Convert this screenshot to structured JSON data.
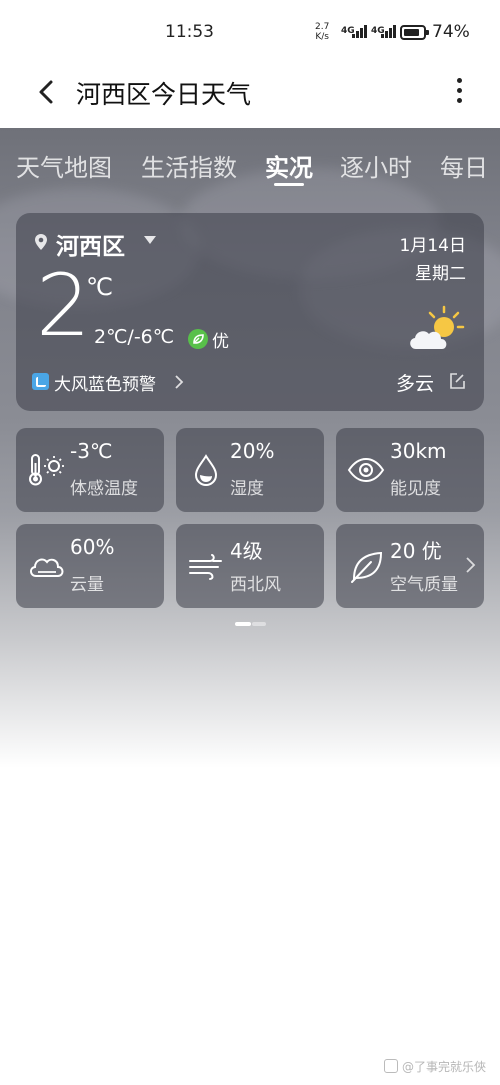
{
  "status_bar": {
    "time": "11:53",
    "net_speed_value": "2.7",
    "net_speed_unit": "K/s",
    "signal_1": "4G",
    "signal_2": "4G",
    "battery": "74%"
  },
  "header": {
    "title": "河西区今日天气",
    "back_icon": "chevron-left-icon",
    "more_icon": "more-vertical-icon"
  },
  "tabs": [
    {
      "label": "天气地图",
      "active": false
    },
    {
      "label": "生活指数",
      "active": false
    },
    {
      "label": "实况",
      "active": true
    },
    {
      "label": "逐小时",
      "active": false
    },
    {
      "label": "每日",
      "active": false
    }
  ],
  "current": {
    "location": "河西区",
    "date": "1月14日",
    "weekday": "星期二",
    "temperature": "2",
    "temperature_unit": "℃",
    "range": "2℃/-6℃",
    "aqi_label": "优",
    "warning": "大风蓝色预警",
    "condition": "多云"
  },
  "details": [
    {
      "value": "-3℃",
      "label": "体感温度",
      "icon": "thermometer-sun-icon"
    },
    {
      "value": "20%",
      "label": "湿度",
      "icon": "water-drop-icon"
    },
    {
      "value": "30km",
      "label": "能见度",
      "icon": "eye-icon"
    },
    {
      "value": "60%",
      "label": "云量",
      "icon": "cloud-icon"
    },
    {
      "value": "4级",
      "label": "西北风",
      "icon": "wind-icon"
    },
    {
      "value": "20 优",
      "label": "空气质量",
      "icon": "leaf-icon"
    }
  ],
  "watermark": "@了事完就乐俠",
  "colors": {
    "aqi_good": "#58c04a",
    "warning_blue": "#4aa6e6"
  }
}
